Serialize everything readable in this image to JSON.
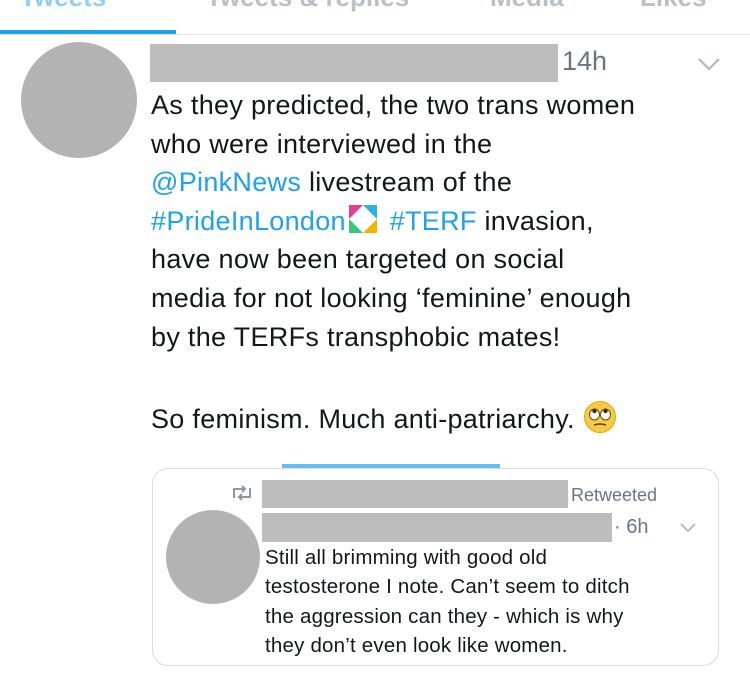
{
  "tabs": [
    {
      "label": "Tweets",
      "active": true
    },
    {
      "label": "Tweets & replies",
      "active": false
    },
    {
      "label": "Media",
      "active": false
    },
    {
      "label": "Likes",
      "active": false
    }
  ],
  "tweet": {
    "time": "14h",
    "lines": [
      [
        {
          "text": "As they predicted, the two trans women",
          "link": false
        }
      ],
      [
        {
          "text": "who were interviewed in the",
          "link": false
        }
      ],
      [
        {
          "text": "@PinkNews",
          "link": true
        },
        {
          "text": " livestream of the",
          "link": false
        }
      ],
      [
        {
          "text": "#PrideInLondon",
          "link": true
        },
        {
          "emoji": "pride-heart"
        },
        {
          "text": " ",
          "link": false
        },
        {
          "text": "#TERF",
          "link": true
        },
        {
          "text": " invasion,",
          "link": false
        }
      ],
      [
        {
          "text": "have now been targeted on social",
          "link": false
        }
      ],
      [
        {
          "text": "media for not looking ‘feminine’ enough",
          "link": false
        }
      ],
      [
        {
          "text": "by the TERFs transphobic mates!",
          "link": false
        }
      ]
    ],
    "closing_line": "So feminism. Much anti-patriarchy.",
    "closing_emoji": "eye-roll-emoji"
  },
  "quoted": {
    "retweeted_label": "Retweeted",
    "time": "· 6h",
    "lines": [
      "Still all brimming with good old",
      "testosterone I note. Can’t seem to ditch",
      "the aggression can they - which is why",
      "they don’t even look like women."
    ]
  },
  "colors": {
    "link": "#1da1f2",
    "text": "#14171a",
    "muted": "#657786",
    "redaction": "#bdbdbd",
    "avatar": "#b3b3b3"
  }
}
